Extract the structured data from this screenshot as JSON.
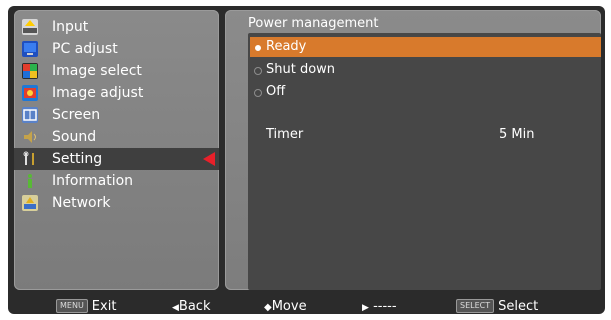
{
  "menu": {
    "items": [
      {
        "label": "Input",
        "icon": "input-icon",
        "color": "#c8c8c8"
      },
      {
        "label": "PC adjust",
        "icon": "monitor-icon",
        "color": "#2a5fd0"
      },
      {
        "label": "Image select",
        "icon": "image-select-icon",
        "color": "#e23d2c"
      },
      {
        "label": "Image adjust",
        "icon": "image-adjust-icon",
        "color": "#1f78d6"
      },
      {
        "label": "Screen",
        "icon": "screen-icon",
        "color": "#7aa0e0"
      },
      {
        "label": "Sound",
        "icon": "speaker-icon",
        "color": "#c5a34a"
      },
      {
        "label": "Setting",
        "icon": "wrench-icon",
        "color": "#c0c0c0"
      },
      {
        "label": "Information",
        "icon": "info-icon",
        "color": "#58b935"
      },
      {
        "label": "Network",
        "icon": "network-icon",
        "color": "#d7c56a"
      }
    ],
    "selected_index": 6
  },
  "panel": {
    "title": "Power management",
    "options": [
      {
        "label": "Ready",
        "selected": true
      },
      {
        "label": "Shut down",
        "selected": false
      },
      {
        "label": "Off",
        "selected": false
      }
    ],
    "timer_label": "Timer",
    "timer_value": "5 Min"
  },
  "bottom_bar": {
    "exit_key": "MENU",
    "exit": "Exit",
    "back_symbol": "◀",
    "back": "Back",
    "move_symbol": "◆",
    "move": "Move",
    "next_symbol": "▶",
    "next": "-----",
    "select_key": "SELECT",
    "select": "Select"
  },
  "colors": {
    "accent": "#d87a2c",
    "selection_arrow": "#e8202a"
  }
}
